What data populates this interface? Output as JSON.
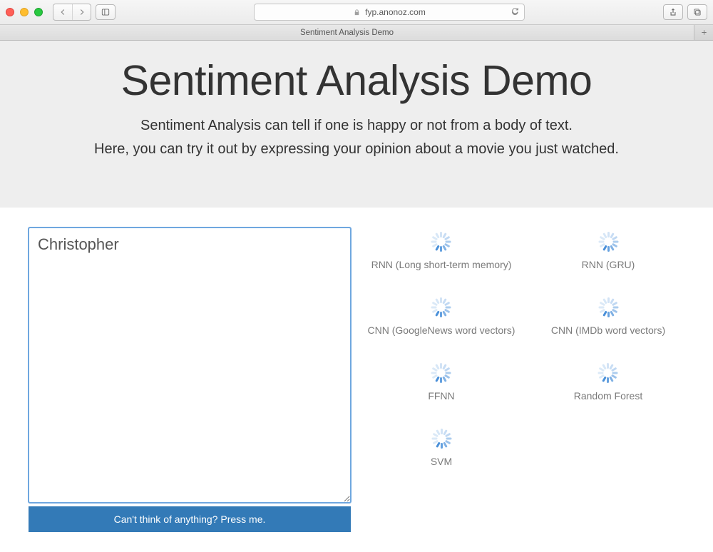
{
  "browser": {
    "url": "fyp.anonoz.com",
    "tab_title": "Sentiment Analysis Demo"
  },
  "hero": {
    "title": "Sentiment Analysis Demo",
    "subtitle1": "Sentiment Analysis can tell if one is happy or not from a body of text.",
    "subtitle2": "Here, you can try it out by expressing your opinion about a movie you just watched."
  },
  "form": {
    "review_text": "Christopher ",
    "suggest_button": "Can't think of anything? Press me."
  },
  "models": {
    "left_column": [
      {
        "label": "RNN (Long short-term memory)"
      },
      {
        "label": "CNN (GoogleNews word vectors)"
      },
      {
        "label": "FFNN"
      },
      {
        "label": "SVM"
      }
    ],
    "right_column": [
      {
        "label": "RNN (GRU)"
      },
      {
        "label": "CNN (IMDb word vectors)"
      },
      {
        "label": "Random Forest"
      }
    ]
  }
}
